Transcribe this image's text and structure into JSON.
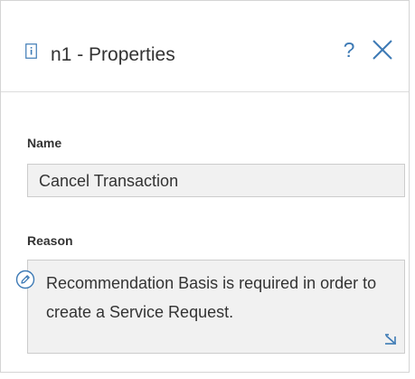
{
  "panel": {
    "title": "n1 - Properties",
    "header_icon": "document-info-icon",
    "help_icon": "?",
    "close_icon": "close-icon"
  },
  "fields": {
    "name": {
      "label": "Name",
      "value": "Cancel Transaction"
    },
    "reason": {
      "label": "Reason",
      "value": "Recommendation Basis is required in order to create a Service Request.",
      "edit_icon": "pencil-edit-icon",
      "resize_icon": "resize-handle-icon"
    }
  },
  "colors": {
    "accent": "#3d7ab5",
    "text": "#333333",
    "field_background": "#f1f1f1",
    "border": "#cccccc"
  }
}
